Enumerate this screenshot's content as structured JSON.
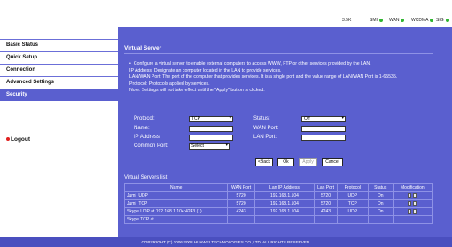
{
  "status_bar": {
    "signal": "3.5K",
    "sms": "SMI",
    "wan": "WAN",
    "wcdma": "WCDMA",
    "sig": "SIG"
  },
  "sidebar": {
    "items": [
      {
        "label": "Basic Status"
      },
      {
        "label": "Quick Setup"
      },
      {
        "label": "Connection"
      },
      {
        "label": "Advanced Settings"
      },
      {
        "label": "Security"
      }
    ],
    "logout": "Logout"
  },
  "main": {
    "title": "Virtual Server",
    "description": [
      "Configure a virtual server to enable external computers to access WWW, FTP or other services provided by the LAN.",
      "IP Address: Designate an computer located in the LAN to provide services.",
      "LAN/WAN Port: The port of the computer that provides services. It is a single port and the value range of LAN/WAN Port is 1-65535.",
      "Protocol: Protocols applied by services.",
      "Note: Settings will not take effect until the \"Apply\" button is clicked."
    ],
    "form": {
      "protocol_label": "Protocol:",
      "protocol_value": "TCP",
      "status_label": "Status:",
      "status_value": "Off",
      "name_label": "Name:",
      "wan_port_label": "WAN Port:",
      "ip_label": "IP Address:",
      "lan_port_label": "LAN Port:",
      "common_port_label": "Common Port:",
      "common_port_value": "Select"
    },
    "buttons": {
      "back": "<Back",
      "ok": "Ok",
      "apply": "Apply",
      "cancel": "Cancel"
    },
    "list": {
      "title": "Virtual Servers list",
      "headers": {
        "name": "Name",
        "wan_port": "WAN Port",
        "lan_ip": "Lan IP Address",
        "lan_port": "Lan Port",
        "protocol": "Protocol",
        "status": "Status",
        "modification": "Modification"
      },
      "rows": [
        {
          "name": "Jumi_UDP",
          "wan_port": "5720",
          "lan_ip": "192.168.1.104",
          "lan_port": "5720",
          "protocol": "UDP",
          "status": "On"
        },
        {
          "name": "Jumi_TCP",
          "wan_port": "5720",
          "lan_ip": "192.168.1.104",
          "lan_port": "5720",
          "protocol": "TCP",
          "status": "On"
        },
        {
          "name": "Skype UDP at 192.168.1.104:4243 (1)",
          "wan_port": "4243",
          "lan_ip": "192.168.1.104",
          "lan_port": "4243",
          "protocol": "UDP",
          "status": "On"
        },
        {
          "name": "Skype TCP at",
          "wan_port": "",
          "lan_ip": "",
          "lan_port": "",
          "protocol": "",
          "status": ""
        }
      ]
    }
  },
  "footer": {
    "copyright": "COPYRIGHT (C) 2006-2008 HUAWEI TECHNOLOGIES CO.,LTD. ALL RIGHTS RESERVED."
  }
}
